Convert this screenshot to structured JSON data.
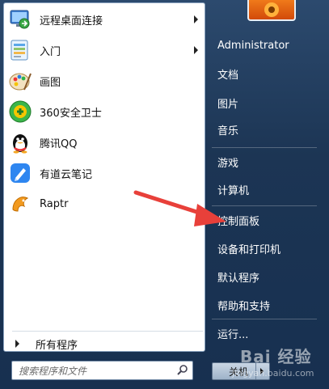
{
  "left_pane": {
    "programs": [
      {
        "label": "远程桌面连接",
        "icon": "remote-desktop-icon",
        "has_arrow": true
      },
      {
        "label": "入门",
        "icon": "getting-started-icon",
        "has_arrow": true
      },
      {
        "label": "画图",
        "icon": "paint-icon",
        "has_arrow": false
      },
      {
        "label": "360安全卫士",
        "icon": "360-security-icon",
        "has_arrow": false
      },
      {
        "label": "腾讯QQ",
        "icon": "qq-penguin-icon",
        "has_arrow": false
      },
      {
        "label": "有道云笔记",
        "icon": "youdao-note-icon",
        "has_arrow": false
      },
      {
        "label": "Raptr",
        "icon": "raptr-icon",
        "has_arrow": false
      }
    ],
    "all_programs": "所有程序"
  },
  "search": {
    "placeholder": "搜索程序和文件"
  },
  "right_pane": {
    "user": "Administrator",
    "items": [
      {
        "label": "文档"
      },
      {
        "label": "图片"
      },
      {
        "label": "音乐"
      },
      {
        "label": "游戏"
      },
      {
        "label": "计算机"
      },
      {
        "label": "控制面板"
      },
      {
        "label": "设备和打印机"
      },
      {
        "label": "默认程序"
      },
      {
        "label": "帮助和支持"
      },
      {
        "label": "运行..."
      }
    ],
    "shutdown_label": "关机"
  },
  "watermark": {
    "logo": "Bai 经验",
    "url": "jingyan.baidu.com"
  },
  "colors": {
    "annotation_arrow": "#e8403a",
    "left_pane_bg": "#ffffff",
    "right_pane_bg": "#1c3554"
  }
}
